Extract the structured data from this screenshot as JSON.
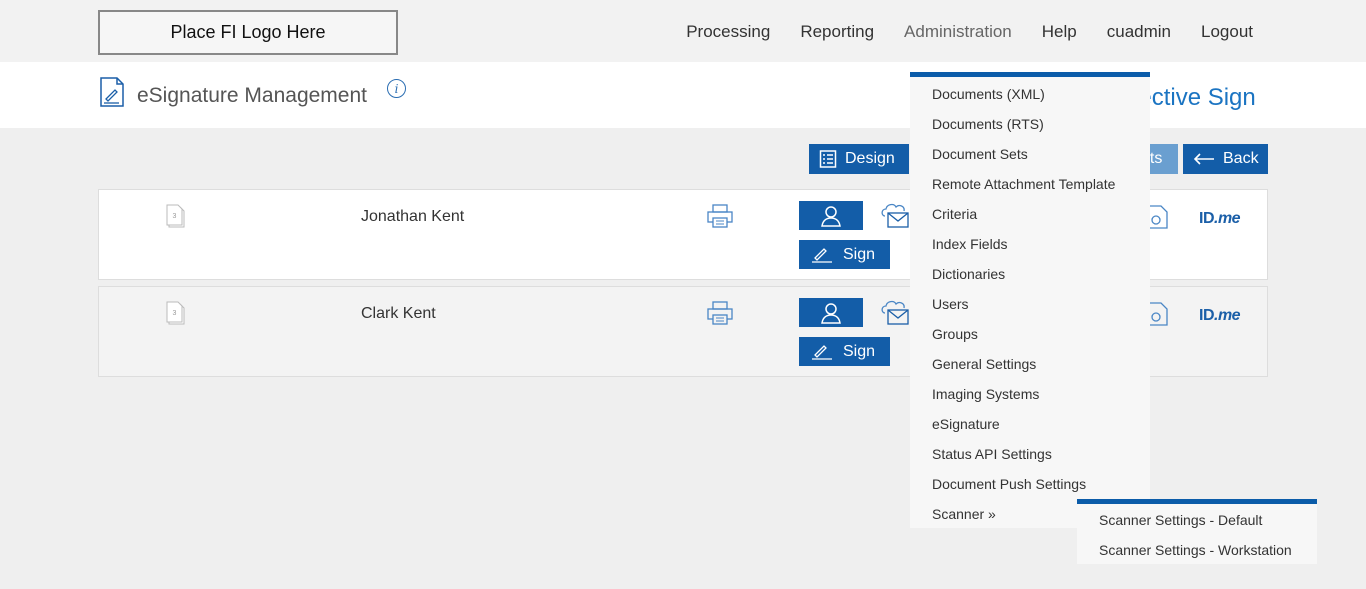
{
  "logo": {
    "text": "Place FI Logo Here"
  },
  "nav": {
    "items": [
      "Processing",
      "Reporting",
      "Administration",
      "Help",
      "cuadmin",
      "Logout"
    ]
  },
  "header": {
    "title": "eSignature Management",
    "info": "i",
    "right_title": "nective Sign"
  },
  "toolbar": {
    "design_label": "Design",
    "partial_label": "nts",
    "back_label": "Back"
  },
  "rows": [
    {
      "doc_count": "3",
      "name": "Jonathan Kent",
      "sign_label": "Sign",
      "idme_id": "ID",
      "idme_me": ".me"
    },
    {
      "doc_count": "3",
      "name": "Clark Kent",
      "sign_label": "Sign",
      "idme_id": "ID",
      "idme_me": ".me"
    }
  ],
  "admin_menu": {
    "items": [
      "Documents (XML)",
      "Documents (RTS)",
      "Document Sets",
      "Remote Attachment Template",
      "Criteria",
      "Index Fields",
      "Dictionaries",
      "Users",
      "Groups",
      "General Settings",
      "Imaging Systems",
      "eSignature",
      "Status API Settings",
      "Document Push Settings",
      "Scanner »"
    ]
  },
  "scanner_menu": {
    "items": [
      "Scanner Settings - Default",
      "Scanner Settings - Workstation"
    ]
  },
  "colors": {
    "primary": "#135da8",
    "link": "#1b74c2",
    "menu_accent": "#0b5ca9"
  }
}
